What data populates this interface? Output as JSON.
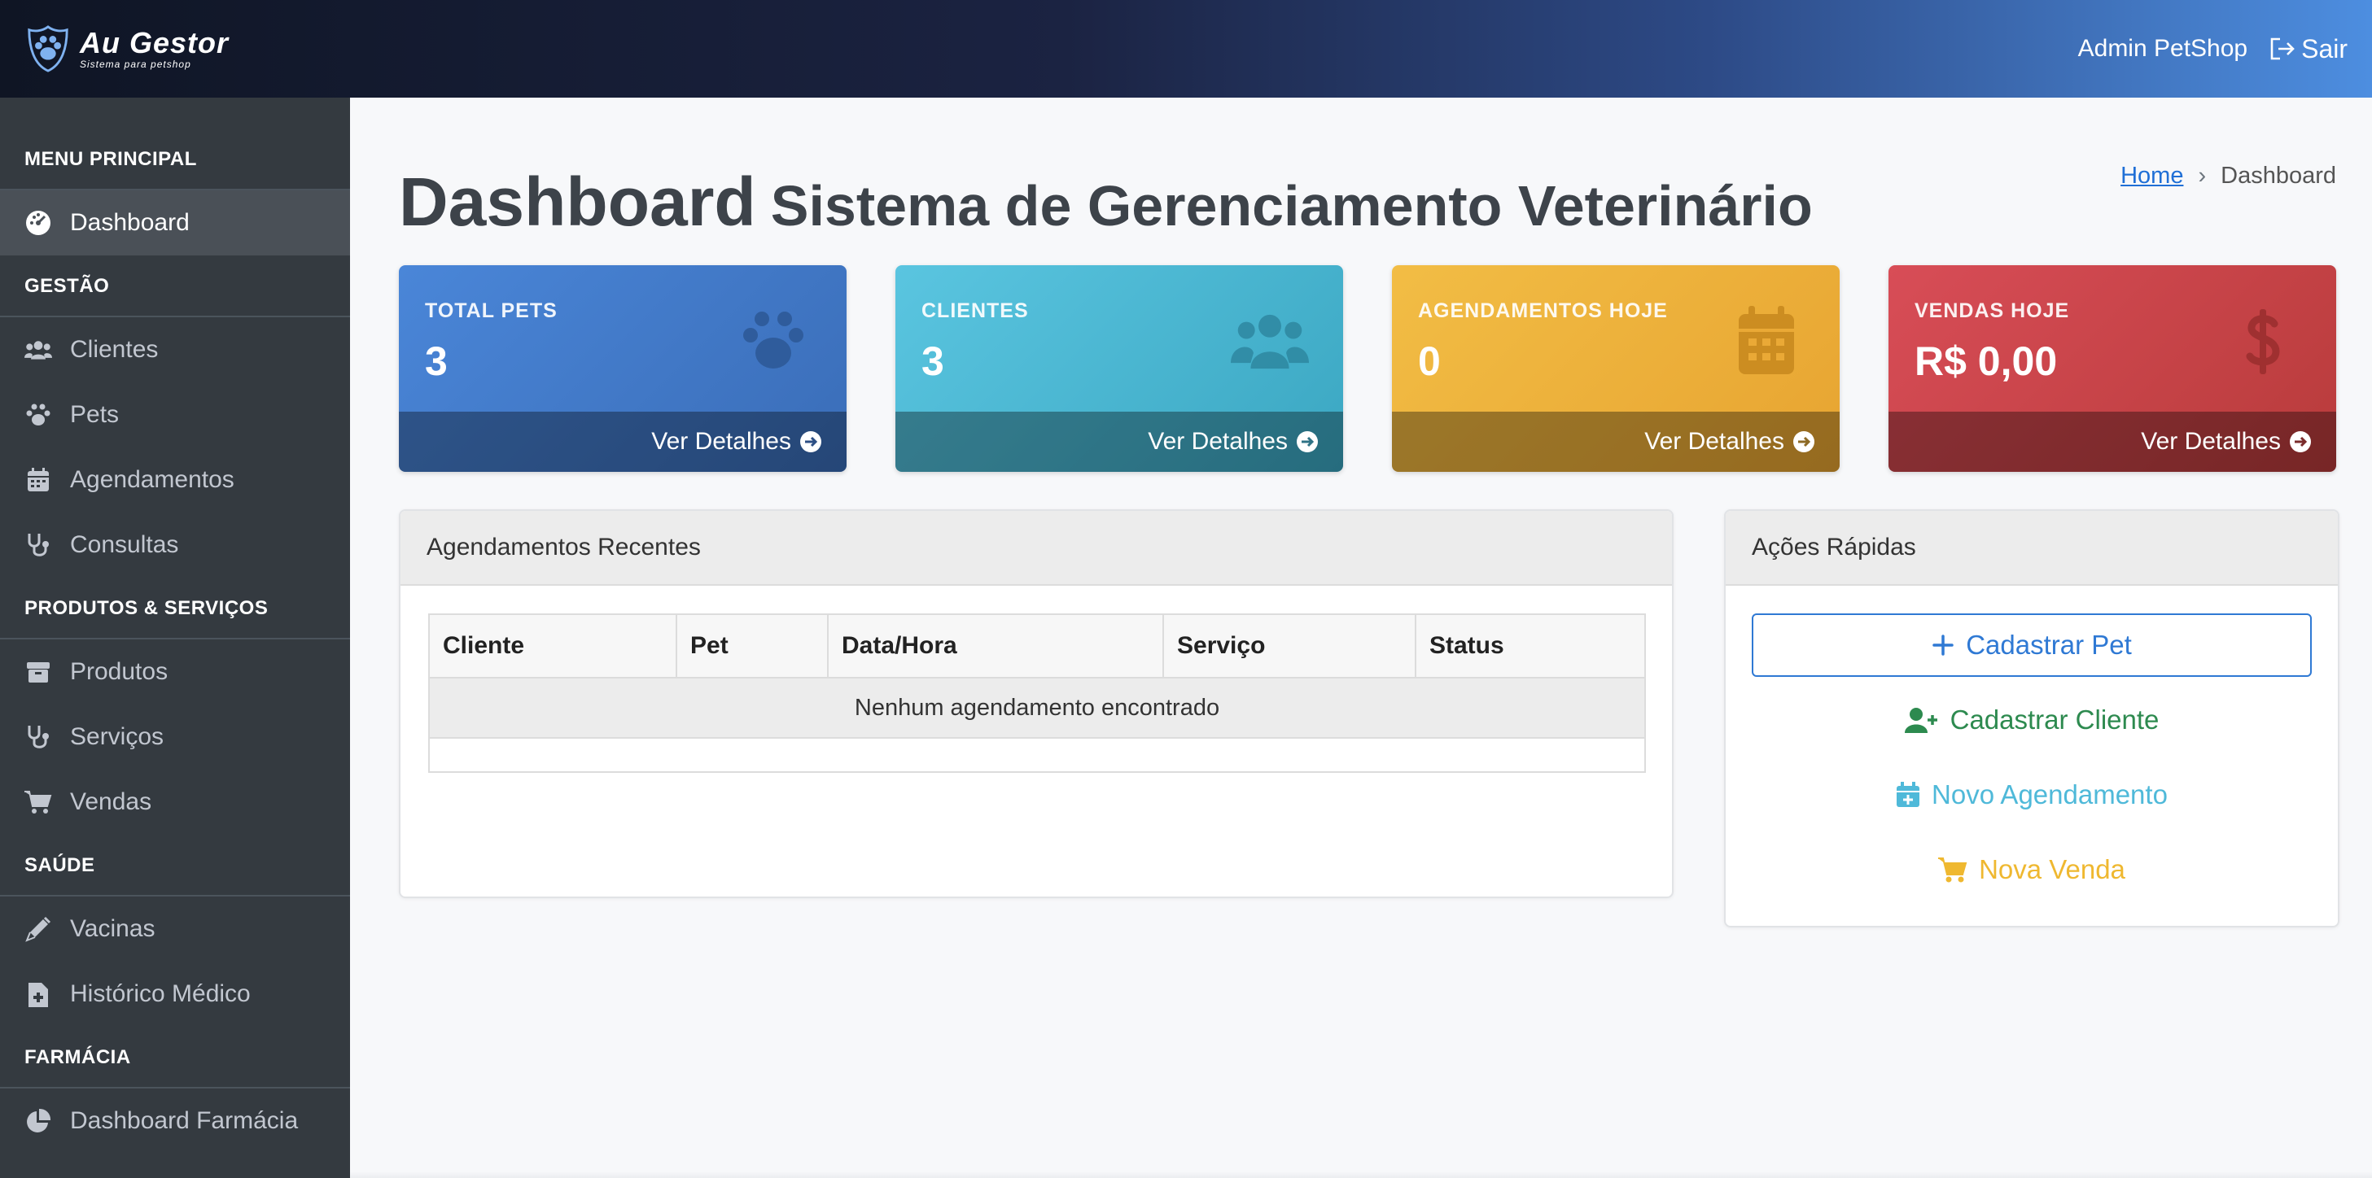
{
  "brand": {
    "name": "Au Gestor",
    "tagline": "Sistema para petshop"
  },
  "topbar": {
    "user": "Admin PetShop",
    "logout_label": "Sair"
  },
  "sidebar": {
    "sections": [
      {
        "header": "MENU PRINCIPAL",
        "items": [
          {
            "label": "Dashboard",
            "icon": "dashboard-icon",
            "active": true
          }
        ]
      },
      {
        "header": "GESTÃO",
        "items": [
          {
            "label": "Clientes",
            "icon": "users-icon"
          },
          {
            "label": "Pets",
            "icon": "paw-icon"
          },
          {
            "label": "Agendamentos",
            "icon": "calendar-icon"
          },
          {
            "label": "Consultas",
            "icon": "stethoscope-icon"
          }
        ]
      },
      {
        "header": "PRODUTOS & SERVIÇOS",
        "items": [
          {
            "label": "Produtos",
            "icon": "box-icon"
          },
          {
            "label": "Serviços",
            "icon": "stethoscope-icon"
          },
          {
            "label": "Vendas",
            "icon": "cart-icon"
          }
        ]
      },
      {
        "header": "SAÚDE",
        "items": [
          {
            "label": "Vacinas",
            "icon": "syringe-icon"
          },
          {
            "label": "Histórico Médico",
            "icon": "medical-file-icon"
          }
        ]
      },
      {
        "header": "FARMÁCIA",
        "items": [
          {
            "label": "Dashboard Farmácia",
            "icon": "pie-chart-icon"
          }
        ]
      }
    ]
  },
  "page": {
    "title": "Dashboard",
    "subtitle": "Sistema de Gerenciamento Veterinário"
  },
  "breadcrumb": {
    "home": "Home",
    "separator": "›",
    "current": "Dashboard"
  },
  "cards": [
    {
      "label": "TOTAL PETS",
      "value": "3",
      "footer": "Ver Detalhes",
      "color": "#4a86d8",
      "icon": "paw-icon"
    },
    {
      "label": "CLIENTES",
      "value": "3",
      "footer": "Ver Detalhes",
      "color": "#5ac5e0",
      "icon": "users-icon"
    },
    {
      "label": "AGENDAMENTOS HOJE",
      "value": "0",
      "footer": "Ver Detalhes",
      "color": "#f2bd45",
      "icon": "calendar-icon"
    },
    {
      "label": "VENDAS HOJE",
      "value": "R$ 0,00",
      "footer": "Ver Detalhes",
      "color": "#d84d57",
      "icon": "dollar-icon"
    }
  ],
  "recent": {
    "title": "Agendamentos Recentes",
    "columns": [
      "Cliente",
      "Pet",
      "Data/Hora",
      "Serviço",
      "Status"
    ],
    "empty": "Nenhum agendamento encontrado"
  },
  "quick": {
    "title": "Ações Rápidas",
    "actions": [
      {
        "label": "Cadastrar Pet",
        "icon": "plus-icon",
        "color": "#2f79d4"
      },
      {
        "label": "Cadastrar Cliente",
        "icon": "user-plus-icon",
        "color": "#2d8a4f"
      },
      {
        "label": "Novo Agendamento",
        "icon": "calendar-plus-icon",
        "color": "#4fb9d9"
      },
      {
        "label": "Nova Venda",
        "icon": "cart-icon",
        "color": "#efb830"
      }
    ]
  }
}
